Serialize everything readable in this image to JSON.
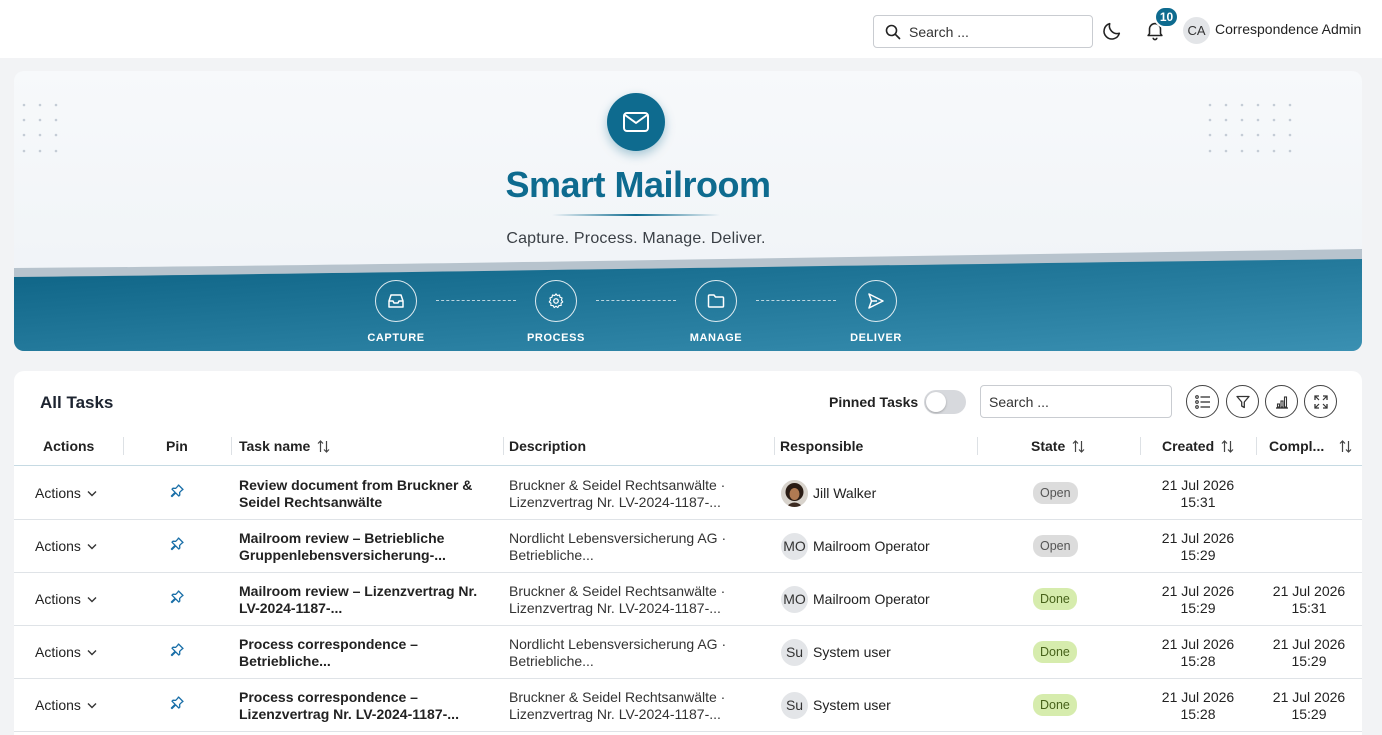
{
  "header": {
    "search_placeholder": "Search ...",
    "notification_count": "10",
    "user_initials": "CA",
    "user_name": "Correspondence Admin"
  },
  "hero": {
    "title": "Smart Mailroom",
    "subtitle": "Capture. Process. Manage. Deliver.",
    "steps": [
      {
        "label": "CAPTURE",
        "icon": "inbox-icon"
      },
      {
        "label": "PROCESS",
        "icon": "gear-icon"
      },
      {
        "label": "MANAGE",
        "icon": "folder-icon"
      },
      {
        "label": "DELIVER",
        "icon": "send-icon"
      }
    ]
  },
  "tasks": {
    "title": "All Tasks",
    "pinned_label": "Pinned Tasks",
    "pinned_enabled": false,
    "search_placeholder": "Search ...",
    "columns": {
      "actions": "Actions",
      "pin": "Pin",
      "task_name": "Task name",
      "description": "Description",
      "responsible": "Responsible",
      "state": "State",
      "created": "Created",
      "completed": "Compl..."
    },
    "rows": [
      {
        "actions": "Actions",
        "task_name": "Review document from Bruckner & Seidel Rechtsanwälte",
        "description": "Bruckner & Seidel Rechtsanwälte · Lizenzvertrag Nr. LV-2024-1187-...",
        "responsible_initials": "",
        "responsible": "Jill Walker",
        "state": "Open",
        "created_date": "21 Jul 2026",
        "created_time": "15:31",
        "completed_date": "",
        "completed_time": ""
      },
      {
        "actions": "Actions",
        "task_name": "Mailroom review – Betriebliche Gruppenlebensversicherung-...",
        "description": "Nordlicht Lebensversicherung AG · Betriebliche...",
        "responsible_initials": "MO",
        "responsible": "Mailroom Operator",
        "state": "Open",
        "created_date": "21 Jul 2026",
        "created_time": "15:29",
        "completed_date": "",
        "completed_time": ""
      },
      {
        "actions": "Actions",
        "task_name": "Mailroom review – Lizenzvertrag Nr. LV-2024-1187-...",
        "description": "Bruckner & Seidel Rechtsanwälte · Lizenzvertrag Nr. LV-2024-1187-...",
        "responsible_initials": "MO",
        "responsible": "Mailroom Operator",
        "state": "Done",
        "created_date": "21 Jul 2026",
        "created_time": "15:29",
        "completed_date": "21 Jul 2026",
        "completed_time": "15:31"
      },
      {
        "actions": "Actions",
        "task_name": "Process correspondence – Betriebliche...",
        "description": "Nordlicht Lebensversicherung AG · Betriebliche...",
        "responsible_initials": "Su",
        "responsible": "System user",
        "state": "Done",
        "created_date": "21 Jul 2026",
        "created_time": "15:28",
        "completed_date": "21 Jul 2026",
        "completed_time": "15:29"
      },
      {
        "actions": "Actions",
        "task_name": "Process correspondence – Lizenzvertrag Nr. LV-2024-1187-...",
        "description": "Bruckner & Seidel Rechtsanwälte · Lizenzvertrag Nr. LV-2024-1187-...",
        "responsible_initials": "Su",
        "responsible": "System user",
        "state": "Done",
        "created_date": "21 Jul 2026",
        "created_time": "15:28",
        "completed_date": "21 Jul 2026",
        "completed_time": "15:29"
      }
    ]
  },
  "colors": {
    "brand": "#0e6b8f",
    "state_open_bg": "#dcdcdc",
    "state_done_bg": "#d6ecad",
    "pin": "#1a6fa8"
  }
}
